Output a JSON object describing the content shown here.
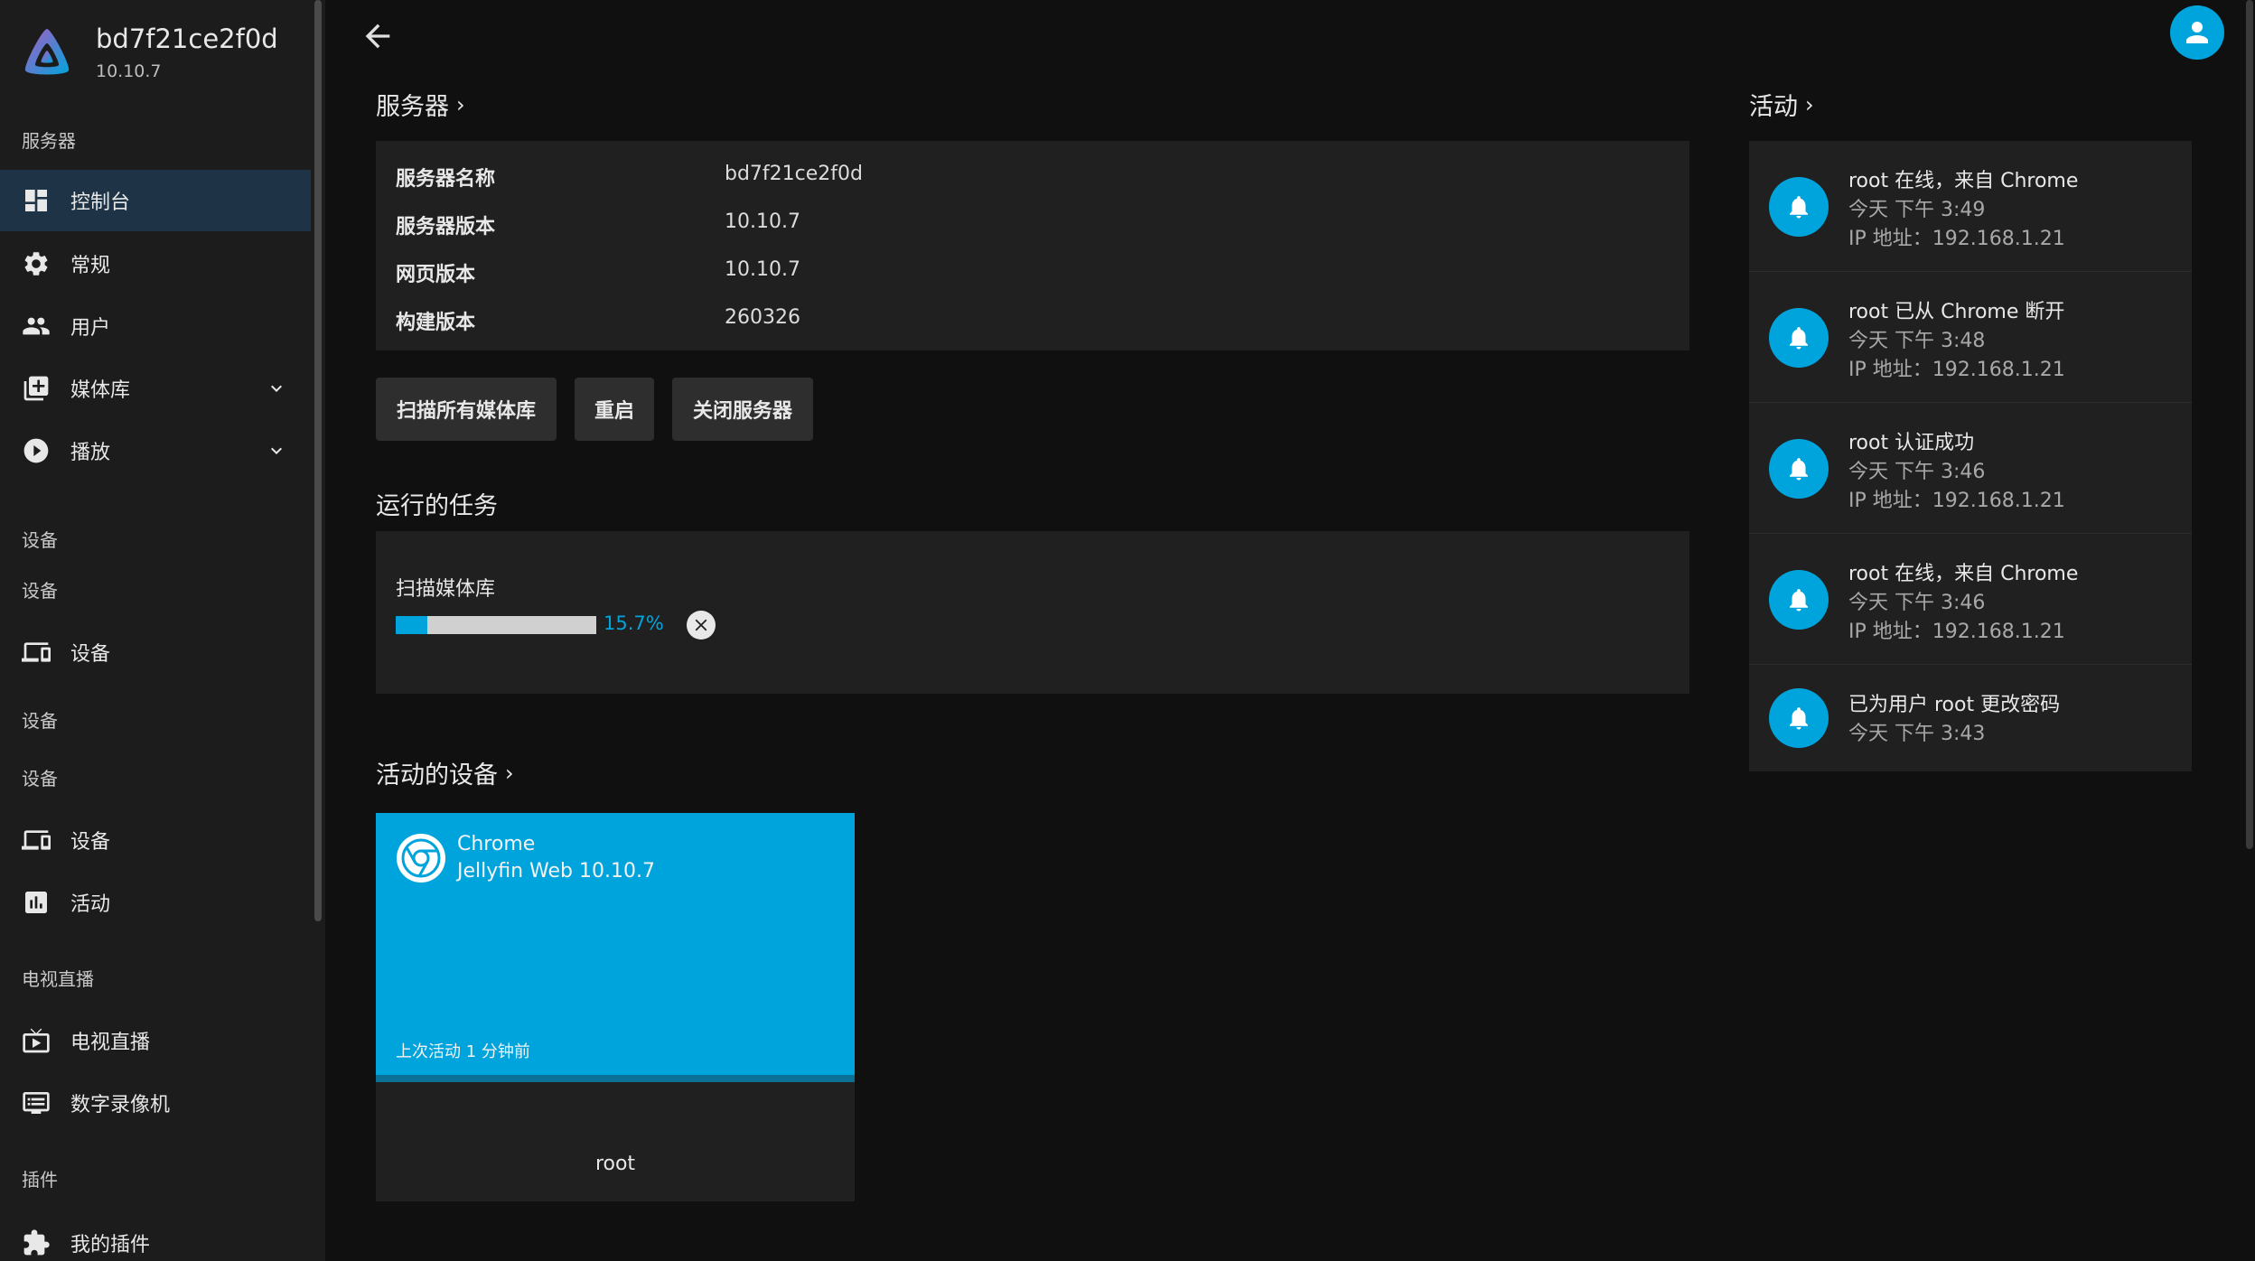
{
  "server": {
    "name": "bd7f21ce2f0d",
    "version": "10.10.7"
  },
  "sidebar": {
    "sections": {
      "server": "服务器",
      "devices": "设备",
      "devices2": "设备",
      "devices3": "设备",
      "devices4": "设备",
      "livetv": "电视直播",
      "plugins": "插件"
    },
    "items": [
      {
        "label": "控制台",
        "icon": "dashboard-icon",
        "active": true
      },
      {
        "label": "常规",
        "icon": "gear-icon"
      },
      {
        "label": "用户",
        "icon": "people-icon"
      },
      {
        "label": "媒体库",
        "icon": "library-add-icon",
        "expandable": true
      },
      {
        "label": "播放",
        "icon": "play-circle-icon",
        "expandable": true
      },
      {
        "label": "设备",
        "icon": "devices-icon"
      },
      {
        "label": "设备",
        "icon": "devices-icon"
      },
      {
        "label": "活动",
        "icon": "assessment-icon"
      },
      {
        "label": "电视直播",
        "icon": "live-tv-icon"
      },
      {
        "label": "数字录像机",
        "icon": "dvr-icon"
      },
      {
        "label": "我的插件",
        "icon": "extension-icon"
      }
    ]
  },
  "main": {
    "server_heading": "服务器",
    "info": [
      {
        "key": "服务器名称",
        "value": "bd7f21ce2f0d"
      },
      {
        "key": "服务器版本",
        "value": "10.10.7"
      },
      {
        "key": "网页版本",
        "value": "10.10.7"
      },
      {
        "key": "构建版本",
        "value": "260326"
      }
    ],
    "buttons": {
      "scan": "扫描所有媒体库",
      "restart": "重启",
      "shutdown": "关闭服务器"
    },
    "tasks_heading": "运行的任务",
    "task": {
      "name": "扫描媒体库",
      "progress": 0.157,
      "progress_text": "15.7%"
    },
    "devices_heading": "活动的设备",
    "device": {
      "app": "Chrome",
      "client": "Jellyfin Web 10.10.7",
      "last_active": "上次活动 1 分钟前",
      "user": "root"
    }
  },
  "activity": {
    "heading": "活动",
    "items": [
      {
        "title": "root 在线，来自 Chrome",
        "time": "今天 下午 3:49",
        "ip": "IP 地址：192.168.1.21"
      },
      {
        "title": "root 已从 Chrome 断开",
        "time": "今天 下午 3:48",
        "ip": "IP 地址：192.168.1.21"
      },
      {
        "title": "root 认证成功",
        "time": "今天 下午 3:46",
        "ip": "IP 地址：192.168.1.21"
      },
      {
        "title": "root 在线，来自 Chrome",
        "time": "今天 下午 3:46",
        "ip": "IP 地址：192.168.1.21"
      },
      {
        "title": "已为用户 root 更改密码",
        "time": "今天 下午 3:43"
      }
    ]
  },
  "colors": {
    "accent": "#00a4dc",
    "background": "#101010",
    "panel": "#202020",
    "sidebar": "#1c1c1c"
  }
}
